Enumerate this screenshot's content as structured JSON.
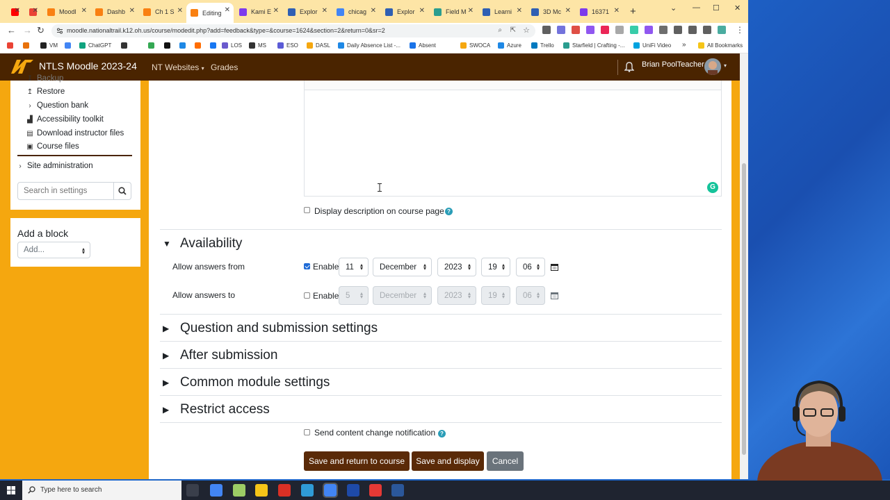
{
  "browser": {
    "tabs": [
      {
        "label": "",
        "color": "#ff0000"
      },
      {
        "label": "",
        "color": "#ea4335"
      },
      {
        "label": "Moodl",
        "color": "#f98012"
      },
      {
        "label": "Dashb",
        "color": "#f98012"
      },
      {
        "label": "Ch 1 S",
        "color": "#f98012"
      },
      {
        "label": "Editing",
        "color": "#f98012",
        "active": true
      },
      {
        "label": "Kami E",
        "color": "#7c3aed"
      },
      {
        "label": "Explor",
        "color": "#2f5fb3"
      },
      {
        "label": "chicag",
        "color": "#4285f4"
      },
      {
        "label": "Explor",
        "color": "#2f5fb3"
      },
      {
        "label": "Field M",
        "color": "#2a9d8f"
      },
      {
        "label": "Learni",
        "color": "#2f5fb3"
      },
      {
        "label": "3D Mc",
        "color": "#2f5fb3"
      },
      {
        "label": "16371",
        "color": "#7c3aed"
      }
    ],
    "new_tab": "+",
    "url": "moodle.nationaltrail.k12.oh.us/course/modedit.php?add=feedback&type=&course=1624&section=2&return=0&sr=2",
    "bookmarks": [
      "VM",
      "ChatGPT",
      "LOS",
      "MS",
      "ESO",
      "DASL",
      "Daily Absence List -...",
      "Absent",
      "SWOCA",
      "Azure",
      "Trello",
      "Starfield | Crafting -...",
      "UniFi Video"
    ],
    "all_bookmarks": "All Bookmarks",
    "more": "»"
  },
  "moodle": {
    "site_name": "NTLS Moodle 2023-24",
    "nav_websites": "NT Websites",
    "nav_grades": "Grades",
    "user_name": "Brian PoolTeacher"
  },
  "sidebar": {
    "items": [
      {
        "label": "Backup",
        "icon": "backup-icon"
      },
      {
        "label": "Restore",
        "icon": "restore-icon"
      },
      {
        "label": "Question bank",
        "icon": "chevron-right-icon"
      },
      {
        "label": "Accessibility toolkit",
        "icon": "chart-icon"
      },
      {
        "label": "Download instructor files",
        "icon": "file-icon"
      },
      {
        "label": "Course files",
        "icon": "file-icon"
      }
    ],
    "site_admin": "Site administration",
    "search_placeholder": "Search in settings",
    "add_block_title": "Add a block",
    "add_block_select": "Add..."
  },
  "form": {
    "display_description": "Display description on course page",
    "availability": {
      "title": "Availability",
      "from_label": "Allow answers from",
      "from_enabled": true,
      "from": {
        "day": "11",
        "month": "December",
        "year": "2023",
        "hour": "19",
        "minute": "06"
      },
      "to_label": "Allow answers to",
      "to_enabled": false,
      "to": {
        "day": "5",
        "month": "December",
        "year": "2023",
        "hour": "19",
        "minute": "06"
      },
      "enable_label": "Enable"
    },
    "sections": [
      "Question and submission settings",
      "After submission",
      "Common module settings",
      "Restrict access"
    ],
    "send_notification": "Send content change notification",
    "buttons": {
      "save_return": "Save and return to course",
      "save_display": "Save and display",
      "cancel": "Cancel"
    }
  },
  "taskbar": {
    "search": "Type here to search"
  },
  "colors": {
    "moodle_nav": "#4a2400",
    "accent_bg": "#f5a70f",
    "primary_button": "#5a2a08",
    "cancel_button": "#6a737b"
  }
}
